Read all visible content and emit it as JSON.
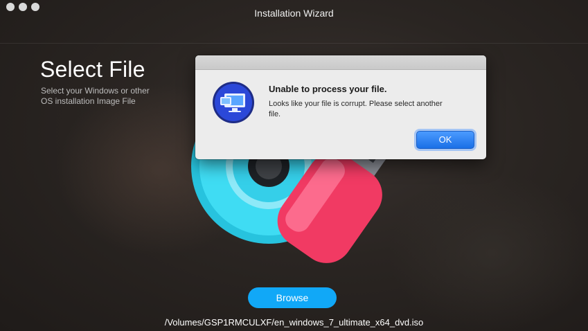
{
  "window": {
    "title": "Installation Wizard"
  },
  "page": {
    "heading": "Select File",
    "subtext": "Select your Windows or other OS installation Image File",
    "browse_label": "Browse",
    "file_path": "/Volumes/GSP1RMCULXF/en_windows_7_ultimate_x64_dvd.iso"
  },
  "dialog": {
    "title": "Unable to process your file.",
    "message": "Looks like your file is corrupt. Please select another  file.",
    "ok_label": "OK",
    "icon": "monitor-app-icon"
  },
  "colors": {
    "accent": "#11a8f7",
    "ok_button": "#1a6fe6",
    "disc": "#2fd3f0",
    "usb": "#f23a68"
  }
}
